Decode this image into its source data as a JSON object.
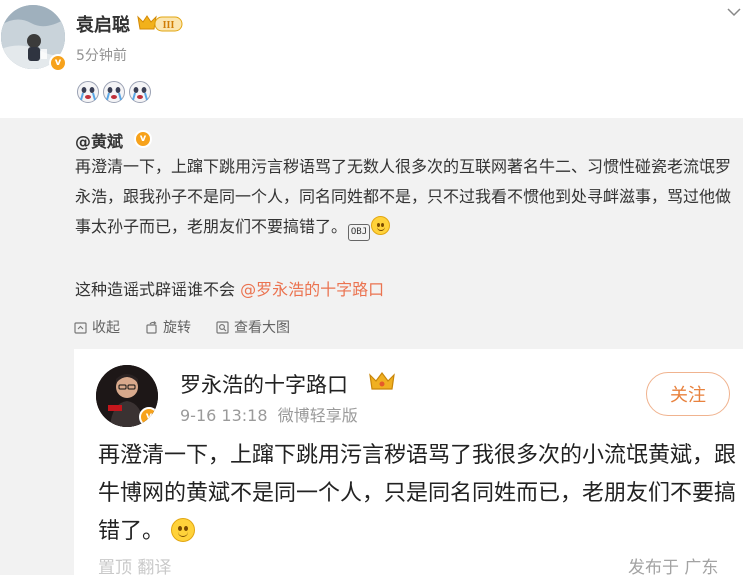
{
  "post": {
    "username": "袁启聪",
    "level_badge": "III",
    "time": "5分钟前",
    "emoji_count": 3
  },
  "repost": {
    "original_user": "@黄斌",
    "text_main": "再澄清一下，上蹿下跳用污言秽语骂了无数人很多次的互联网著名牛二、习惯性碰瓷老流氓罗永浩，跟我孙子不是同一个人，同名同姓都不是，只不过我看不惯他到处寻衅滋事，骂过他做事太孙子而已，老朋友们不要搞错了。",
    "obj_label": "OBJ",
    "comment_prefix": "这种造谣式辟谣谁不会 ",
    "comment_mention": "@罗永浩的十字路口",
    "actions": {
      "collect": "收起",
      "rotate": "旋转",
      "view_large": "查看大图"
    }
  },
  "image_card": {
    "name": "罗永浩的十字路口",
    "date": "9-16 13:18",
    "source": "微博轻享版",
    "follow": "关注",
    "text": "再澄清一下，上蹿下跳用污言秽语骂了我很多次的小流氓黄斌，跟牛博网的黄斌不是同一个人，只是同名同姓而已，老朋友们不要搞错了。",
    "footer_left": "置顶 翻译",
    "footer_right": "发布于 广东"
  },
  "colors": {
    "accent_orange": "#eb7350",
    "verified_badge": "#f7a21b",
    "repost_background": "#f2f2f2"
  }
}
